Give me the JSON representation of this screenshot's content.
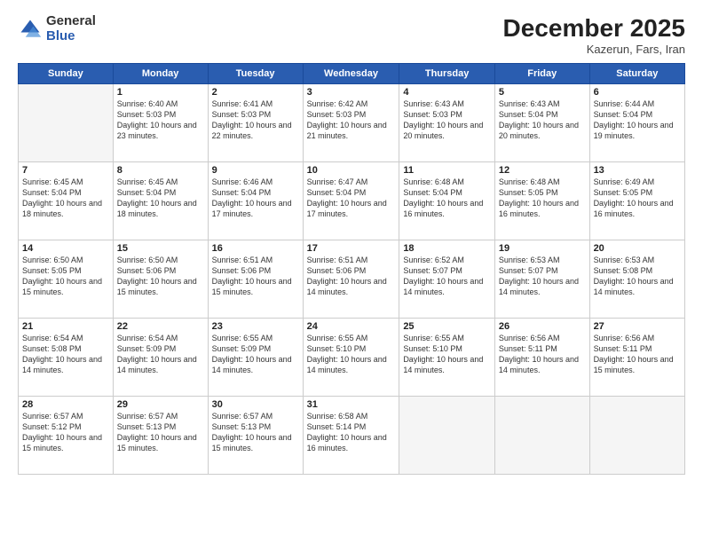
{
  "logo": {
    "general": "General",
    "blue": "Blue"
  },
  "header": {
    "month": "December 2025",
    "location": "Kazerun, Fars, Iran"
  },
  "weekdays": [
    "Sunday",
    "Monday",
    "Tuesday",
    "Wednesday",
    "Thursday",
    "Friday",
    "Saturday"
  ],
  "weeks": [
    [
      {
        "day": "",
        "detail": ""
      },
      {
        "day": "1",
        "detail": "Sunrise: 6:40 AM\nSunset: 5:03 PM\nDaylight: 10 hours\nand 23 minutes."
      },
      {
        "day": "2",
        "detail": "Sunrise: 6:41 AM\nSunset: 5:03 PM\nDaylight: 10 hours\nand 22 minutes."
      },
      {
        "day": "3",
        "detail": "Sunrise: 6:42 AM\nSunset: 5:03 PM\nDaylight: 10 hours\nand 21 minutes."
      },
      {
        "day": "4",
        "detail": "Sunrise: 6:43 AM\nSunset: 5:03 PM\nDaylight: 10 hours\nand 20 minutes."
      },
      {
        "day": "5",
        "detail": "Sunrise: 6:43 AM\nSunset: 5:04 PM\nDaylight: 10 hours\nand 20 minutes."
      },
      {
        "day": "6",
        "detail": "Sunrise: 6:44 AM\nSunset: 5:04 PM\nDaylight: 10 hours\nand 19 minutes."
      }
    ],
    [
      {
        "day": "7",
        "detail": "Sunrise: 6:45 AM\nSunset: 5:04 PM\nDaylight: 10 hours\nand 18 minutes."
      },
      {
        "day": "8",
        "detail": "Sunrise: 6:45 AM\nSunset: 5:04 PM\nDaylight: 10 hours\nand 18 minutes."
      },
      {
        "day": "9",
        "detail": "Sunrise: 6:46 AM\nSunset: 5:04 PM\nDaylight: 10 hours\nand 17 minutes."
      },
      {
        "day": "10",
        "detail": "Sunrise: 6:47 AM\nSunset: 5:04 PM\nDaylight: 10 hours\nand 17 minutes."
      },
      {
        "day": "11",
        "detail": "Sunrise: 6:48 AM\nSunset: 5:04 PM\nDaylight: 10 hours\nand 16 minutes."
      },
      {
        "day": "12",
        "detail": "Sunrise: 6:48 AM\nSunset: 5:05 PM\nDaylight: 10 hours\nand 16 minutes."
      },
      {
        "day": "13",
        "detail": "Sunrise: 6:49 AM\nSunset: 5:05 PM\nDaylight: 10 hours\nand 16 minutes."
      }
    ],
    [
      {
        "day": "14",
        "detail": "Sunrise: 6:50 AM\nSunset: 5:05 PM\nDaylight: 10 hours\nand 15 minutes."
      },
      {
        "day": "15",
        "detail": "Sunrise: 6:50 AM\nSunset: 5:06 PM\nDaylight: 10 hours\nand 15 minutes."
      },
      {
        "day": "16",
        "detail": "Sunrise: 6:51 AM\nSunset: 5:06 PM\nDaylight: 10 hours\nand 15 minutes."
      },
      {
        "day": "17",
        "detail": "Sunrise: 6:51 AM\nSunset: 5:06 PM\nDaylight: 10 hours\nand 14 minutes."
      },
      {
        "day": "18",
        "detail": "Sunrise: 6:52 AM\nSunset: 5:07 PM\nDaylight: 10 hours\nand 14 minutes."
      },
      {
        "day": "19",
        "detail": "Sunrise: 6:53 AM\nSunset: 5:07 PM\nDaylight: 10 hours\nand 14 minutes."
      },
      {
        "day": "20",
        "detail": "Sunrise: 6:53 AM\nSunset: 5:08 PM\nDaylight: 10 hours\nand 14 minutes."
      }
    ],
    [
      {
        "day": "21",
        "detail": "Sunrise: 6:54 AM\nSunset: 5:08 PM\nDaylight: 10 hours\nand 14 minutes."
      },
      {
        "day": "22",
        "detail": "Sunrise: 6:54 AM\nSunset: 5:09 PM\nDaylight: 10 hours\nand 14 minutes."
      },
      {
        "day": "23",
        "detail": "Sunrise: 6:55 AM\nSunset: 5:09 PM\nDaylight: 10 hours\nand 14 minutes."
      },
      {
        "day": "24",
        "detail": "Sunrise: 6:55 AM\nSunset: 5:10 PM\nDaylight: 10 hours\nand 14 minutes."
      },
      {
        "day": "25",
        "detail": "Sunrise: 6:55 AM\nSunset: 5:10 PM\nDaylight: 10 hours\nand 14 minutes."
      },
      {
        "day": "26",
        "detail": "Sunrise: 6:56 AM\nSunset: 5:11 PM\nDaylight: 10 hours\nand 14 minutes."
      },
      {
        "day": "27",
        "detail": "Sunrise: 6:56 AM\nSunset: 5:11 PM\nDaylight: 10 hours\nand 15 minutes."
      }
    ],
    [
      {
        "day": "28",
        "detail": "Sunrise: 6:57 AM\nSunset: 5:12 PM\nDaylight: 10 hours\nand 15 minutes."
      },
      {
        "day": "29",
        "detail": "Sunrise: 6:57 AM\nSunset: 5:13 PM\nDaylight: 10 hours\nand 15 minutes."
      },
      {
        "day": "30",
        "detail": "Sunrise: 6:57 AM\nSunset: 5:13 PM\nDaylight: 10 hours\nand 15 minutes."
      },
      {
        "day": "31",
        "detail": "Sunrise: 6:58 AM\nSunset: 5:14 PM\nDaylight: 10 hours\nand 16 minutes."
      },
      {
        "day": "",
        "detail": ""
      },
      {
        "day": "",
        "detail": ""
      },
      {
        "day": "",
        "detail": ""
      }
    ]
  ]
}
